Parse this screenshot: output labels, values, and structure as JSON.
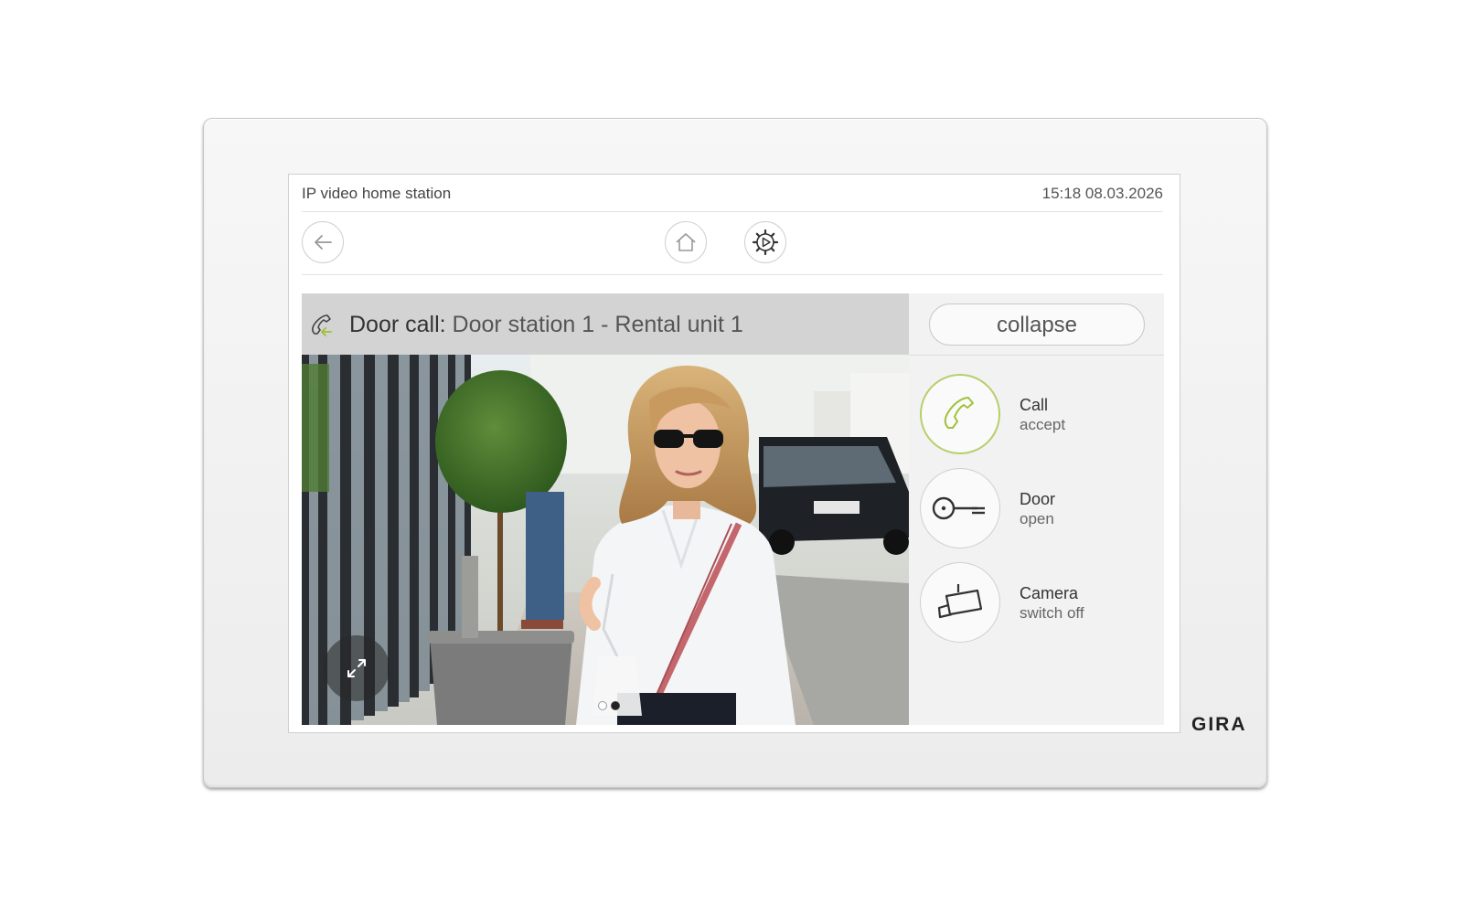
{
  "device": {
    "brand": "GIRA"
  },
  "header": {
    "title": "IP video home station",
    "datetime": "15:18 08.03.2026"
  },
  "nav": {
    "back_icon": "arrow-left-icon",
    "home_icon": "home-icon",
    "settings_icon": "gear-play-icon"
  },
  "call": {
    "label": "Door call:",
    "value": "Door station 1 - Rental unit 1",
    "icon": "incoming-call-icon"
  },
  "video": {
    "page_count": 2,
    "active_page": 1
  },
  "actions": {
    "collapse_label": "collapse",
    "items": [
      {
        "line1": "Call",
        "line2": "accept",
        "icon": "phone-handset-icon"
      },
      {
        "line1": "Door",
        "line2": "open",
        "icon": "key-icon"
      },
      {
        "line1": "Camera",
        "line2": "switch off",
        "icon": "camera-icon"
      }
    ]
  },
  "colors": {
    "accent": "#b5cf6a",
    "header_band": "#d3d3d3",
    "panel": "#f2f2f2"
  }
}
